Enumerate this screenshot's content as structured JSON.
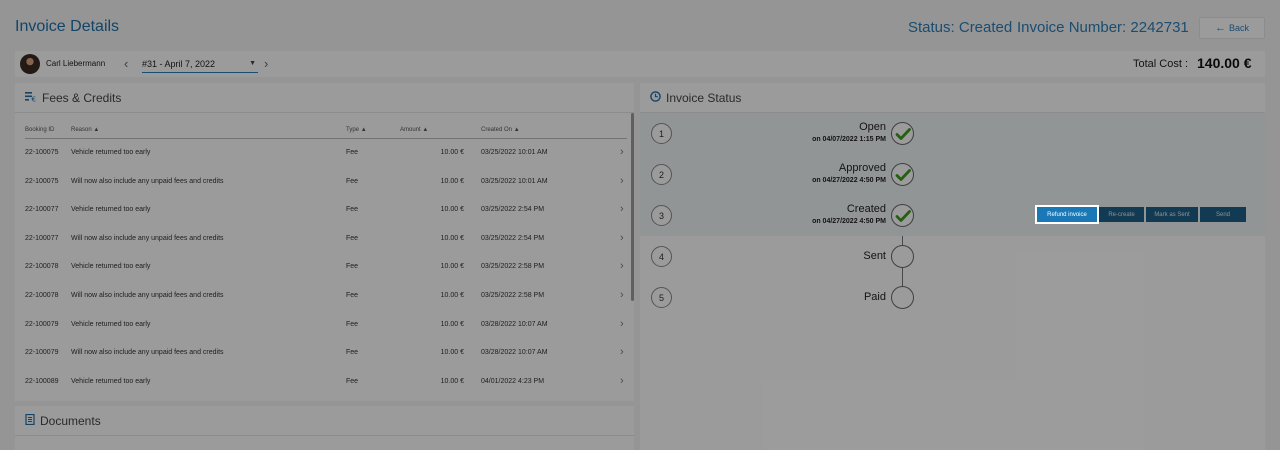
{
  "header": {
    "title": "Invoice Details",
    "status": "Status: Created",
    "invoice_number": "Invoice Number: 2242731",
    "back_label": "Back"
  },
  "toolbar": {
    "user_name": "Carl Liebermann",
    "period": "#31 - April 7, 2022",
    "total_label": "Total Cost :",
    "total_value": "140.00 €"
  },
  "fees": {
    "title": "Fees & Credits",
    "columns": [
      "Booking ID",
      "Reason",
      "Type",
      "Amount",
      "Created On"
    ],
    "rows": [
      {
        "booking": "22-100075",
        "reason": "Vehicle returned too early",
        "type": "Fee",
        "amount": "10.00 €",
        "created": "03/25/2022 10:01 AM"
      },
      {
        "booking": "22-100075",
        "reason": "Will now also include any unpaid fees and credits",
        "type": "Fee",
        "amount": "10.00 €",
        "created": "03/25/2022 10:01 AM"
      },
      {
        "booking": "22-100077",
        "reason": "Vehicle returned too early",
        "type": "Fee",
        "amount": "10.00 €",
        "created": "03/25/2022 2:54 PM"
      },
      {
        "booking": "22-100077",
        "reason": "Will now also include any unpaid fees and credits",
        "type": "Fee",
        "amount": "10.00 €",
        "created": "03/25/2022 2:54 PM"
      },
      {
        "booking": "22-100078",
        "reason": "Vehicle returned too early",
        "type": "Fee",
        "amount": "10.00 €",
        "created": "03/25/2022 2:58 PM"
      },
      {
        "booking": "22-100078",
        "reason": "Will now also include any unpaid fees and credits",
        "type": "Fee",
        "amount": "10.00 €",
        "created": "03/25/2022 2:58 PM"
      },
      {
        "booking": "22-100079",
        "reason": "Vehicle returned too early",
        "type": "Fee",
        "amount": "10.00 €",
        "created": "03/28/2022 10:07 AM"
      },
      {
        "booking": "22-100079",
        "reason": "Will now also include any unpaid fees and credits",
        "type": "Fee",
        "amount": "10.00 €",
        "created": "03/28/2022 10:07 AM"
      },
      {
        "booking": "22-100089",
        "reason": "Vehicle returned too early",
        "type": "Fee",
        "amount": "10.00 €",
        "created": "04/01/2022 4:23 PM"
      }
    ]
  },
  "documents": {
    "title": "Documents"
  },
  "invoice_status": {
    "title": "Invoice Status",
    "steps": [
      {
        "num": "1",
        "name": "Open",
        "date": "on 04/07/2022 1:15 PM"
      },
      {
        "num": "2",
        "name": "Approved",
        "date": "on 04/27/2022 4:50 PM"
      },
      {
        "num": "3",
        "name": "Created",
        "date": "on 04/27/2022 4:50 PM"
      },
      {
        "num": "4",
        "name": "Sent",
        "date": ""
      },
      {
        "num": "5",
        "name": "Paid",
        "date": ""
      }
    ],
    "actions": {
      "refund": "Refund invoice",
      "recreate": "Re-create",
      "mark_sent": "Mark as Sent",
      "send": "Send"
    }
  },
  "colors": {
    "accent": "#1f6fa6",
    "check": "#3c9a1e",
    "action_button": "#1a78b6"
  }
}
